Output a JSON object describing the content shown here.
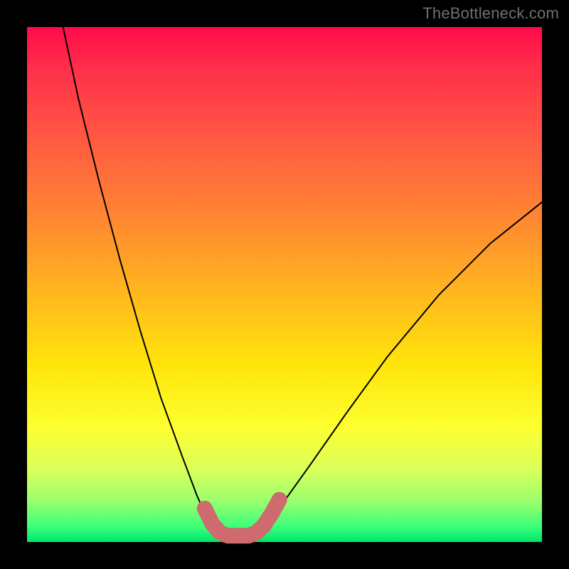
{
  "watermark": "TheBottleneck.com",
  "chart_data": {
    "type": "line",
    "title": "",
    "xlabel": "",
    "ylabel": "",
    "xlim": [
      0,
      100
    ],
    "ylim": [
      0,
      100
    ],
    "grid": false,
    "legend": false,
    "series": [
      {
        "name": "left-branch",
        "x": [
          7,
          10,
          14,
          18,
          22,
          26,
          30,
          33,
          35,
          37,
          38.5
        ],
        "y": [
          100,
          86,
          70,
          55,
          41,
          28,
          17,
          9,
          4.5,
          2,
          1.2
        ]
      },
      {
        "name": "right-branch",
        "x": [
          43.5,
          45,
          47,
          50,
          55,
          62,
          70,
          80,
          90,
          100
        ],
        "y": [
          1.2,
          2,
          4,
          8,
          15,
          25,
          36,
          48,
          58,
          66
        ]
      },
      {
        "name": "highlight-segment",
        "x": [
          34.5,
          36,
          37.5,
          39,
          41,
          43,
          44.5,
          46,
          47.5,
          49
        ],
        "y": [
          6.5,
          3.5,
          1.8,
          1.2,
          1.2,
          1.2,
          1.8,
          3.2,
          5.5,
          8.2
        ]
      }
    ],
    "colors": {
      "curve": "#000000",
      "highlight": "#cf6a6f",
      "gradient_top": "#ff0a4a",
      "gradient_bottom": "#00e56a"
    }
  }
}
